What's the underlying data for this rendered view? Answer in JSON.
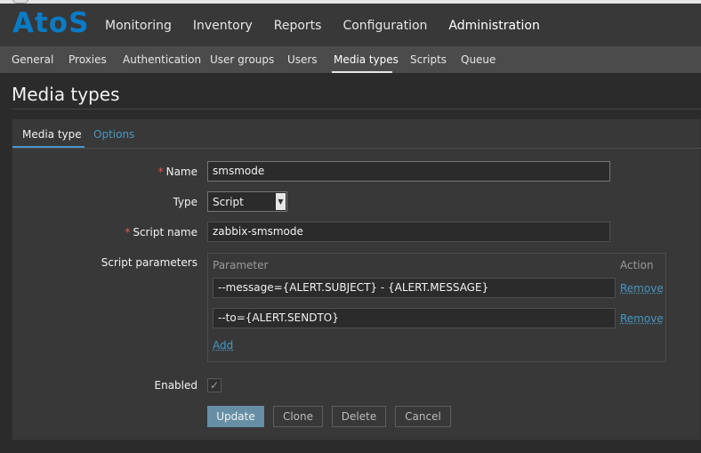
{
  "app": {
    "logo": "AtoS"
  },
  "main_menu": [
    "Monitoring",
    "Inventory",
    "Reports",
    "Configuration",
    "Administration"
  ],
  "main_menu_active": "Administration",
  "sub_menu": [
    "General",
    "Proxies",
    "Authentication",
    "User groups",
    "Users",
    "Media types",
    "Scripts",
    "Queue"
  ],
  "sub_menu_active": "Media types",
  "page_title": "Media types",
  "tabs": {
    "media_type": "Media type",
    "options": "Options"
  },
  "form": {
    "name_label": "Name",
    "name_value": "smsmode",
    "type_label": "Type",
    "type_value": "Script",
    "script_name_label": "Script name",
    "script_name_value": "zabbix-smsmode",
    "script_params_label": "Script parameters",
    "params_header": {
      "parameter": "Parameter",
      "action": "Action"
    },
    "params": [
      {
        "value": "--message={ALERT.SUBJECT} - {ALERT.MESSAGE}",
        "action": "Remove"
      },
      {
        "value": "--to={ALERT.SENDTO}",
        "action": "Remove"
      }
    ],
    "add_label": "Add",
    "enabled_label": "Enabled",
    "enabled_checked": true,
    "required_mark": "*"
  },
  "buttons": {
    "update": "Update",
    "clone": "Clone",
    "delete": "Delete",
    "cancel": "Cancel"
  },
  "colors": {
    "accent": "#0a7bc4",
    "link": "#4796c4",
    "required": "#e45959",
    "primary_button": "#668fa5"
  }
}
